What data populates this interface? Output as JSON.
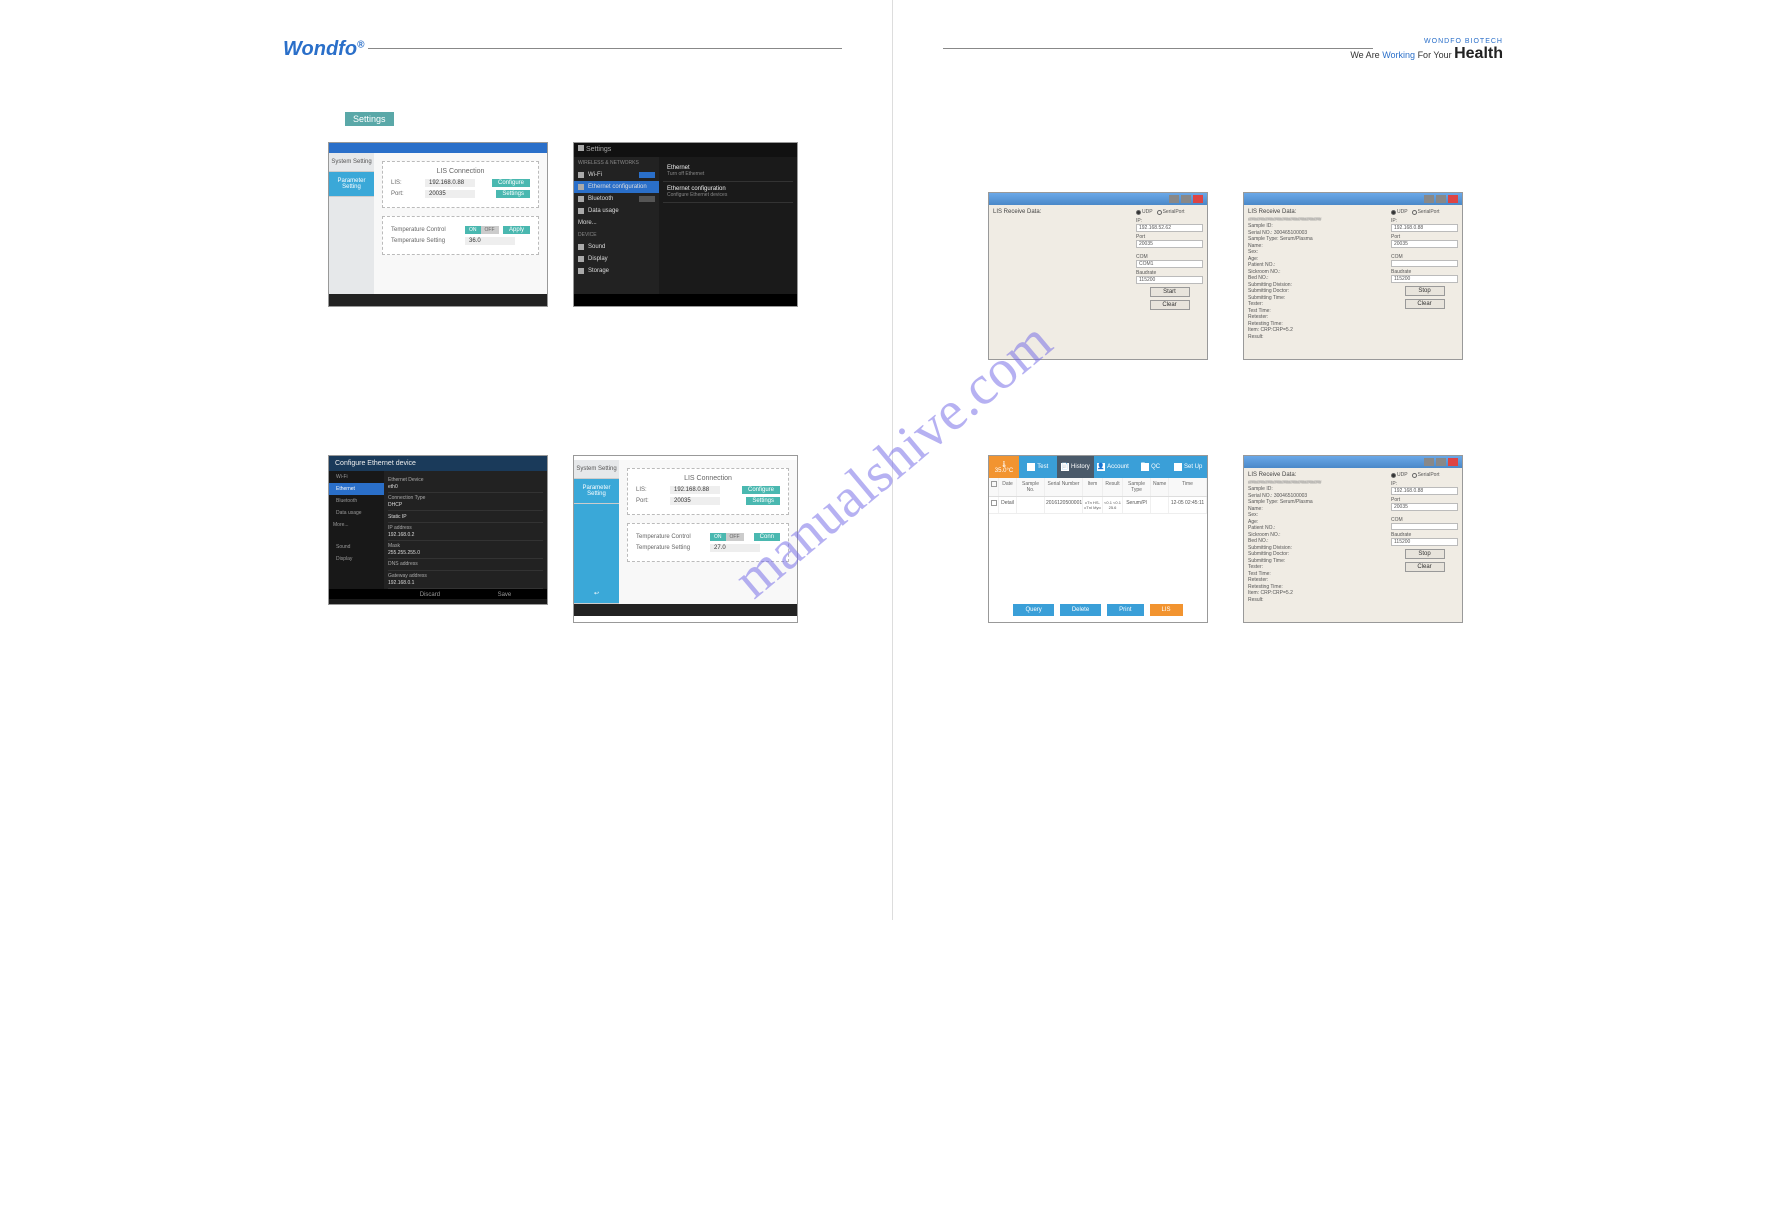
{
  "header": {
    "logo_left": "Wondfo",
    "logo_sup": "®",
    "biotech": "WONDFO BIOTECH",
    "tagline_pre": "We Are ",
    "tagline_blue": "Working ",
    "tagline_mid": "For Your ",
    "health": "Health"
  },
  "watermark": "manualshive.com",
  "settings_badge": "Settings",
  "sys_panel": {
    "side": {
      "system": "System Setting",
      "parameter": "Parameter Setting"
    },
    "lis_title": "LIS Connection",
    "lis_label": "LIS:",
    "lis_value_1": "192.168.0.88",
    "port_label": "Port:",
    "port_value": "20035",
    "configure_btn": "Configure",
    "settings_btn": "Settings",
    "temp_ctrl_label": "Temperature Control",
    "temp_set_label": "Temperature Setting",
    "temp_value_1": "36.0",
    "temp_value_2": "27.0",
    "apply_btn": "Apply",
    "try_btn": "Conn",
    "on": "ON",
    "off": "OFF"
  },
  "android": {
    "title": "Settings",
    "section_wireless": "WIRELESS & NETWORKS",
    "wifi": "Wi-Fi",
    "ethernet_cfg": "Ethernet configuration",
    "bluetooth": "Bluetooth",
    "data_usage": "Data usage",
    "more": "More...",
    "section_device": "DEVICE",
    "sound": "Sound",
    "display": "Display",
    "storage": "Storage",
    "eth_title": "Ethernet",
    "eth_sub": "Turn off Ethernet",
    "eth_cfg_title": "Ethernet configuration",
    "eth_cfg_sub": "Configure Ethernet devices"
  },
  "ethconf": {
    "title": "Configure Ethernet device",
    "dev_label": "Ethernet Device",
    "dev_val": "eth0",
    "conn_label": "Connection Type",
    "conn_val": "DHCP",
    "static_ip": "Static IP",
    "ip_label": "IP address",
    "ip_val": "192.168.0.2",
    "mask_label": "Mask",
    "mask_val": "255.255.255.0",
    "dns_label": "DNS address",
    "gw_label": "Gateway address",
    "gw_val": "192.168.0.1",
    "discard": "Discard",
    "save": "Save"
  },
  "liswin": {
    "title": "LIS Receive Data:",
    "udp": "UDP",
    "serial": "SerialPort",
    "ip_label": "IP:",
    "ip_val_1": "192.168.52.62",
    "ip_val_2": "192.168.0.88",
    "port_label": "Port",
    "port_val": "20035",
    "com_label": "COM",
    "com_val": "COM1",
    "baud_label": "Baudrate",
    "baud_val": "115200",
    "start_btn": "Start",
    "stop_btn": "Stop",
    "clear_btn": "Clear",
    "hashes": "################################",
    "sample_id": "Sample ID:",
    "serial_no": "Serial NO.: 300465100003",
    "sample_type": "Sample Type: Serum/Plasma",
    "name": "Name:",
    "sex": "Sex:",
    "age": "Age:",
    "patient_no": "Patient NO.:",
    "sickroom": "Sickroom NO.:",
    "bed_no": "Bed NO.:",
    "sub_div": "Submitting Division:",
    "sub_doc": "Submitting Doctor:",
    "sub_time": "Submitting Time:",
    "tester": "Tester:",
    "test_time": "Test Time:",
    "retester": "Retester:",
    "ret_time": "Retesting Time:",
    "item": "Item: CRP:CRP=5.2",
    "result": "Result:"
  },
  "analyzer": {
    "temp": "35.0°C",
    "tabs": {
      "test": "Test",
      "history": "History",
      "account": "Account",
      "qc": "QC",
      "setup": "Set Up"
    },
    "cols": [
      "",
      "Date",
      "Sample No.",
      "Serial Number",
      "Item",
      "Result",
      "Sample Type",
      "Name",
      "Time"
    ],
    "row": {
      "date": "",
      "sample_no": "Detail",
      "serial": "20161205000011",
      "item": "cTn HS-cTnI Myo",
      "result": "<0.1 <0.1 25.6",
      "type": "Serum/Pl",
      "name": "",
      "time": "12-05 02:45:11"
    },
    "btns": {
      "query": "Query",
      "delete": "Delete",
      "print": "Print",
      "lis": "LIS"
    }
  }
}
